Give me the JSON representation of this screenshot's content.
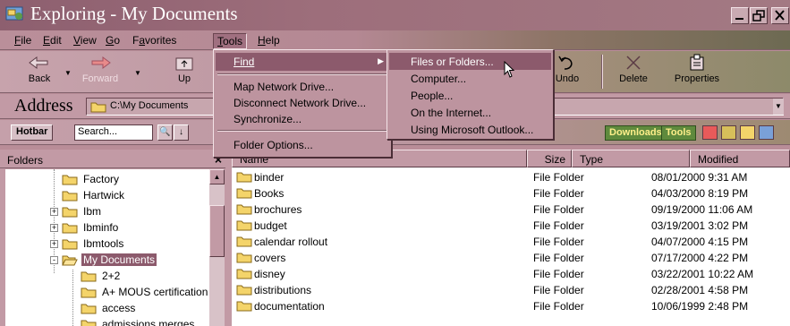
{
  "window": {
    "title": "Exploring - My Documents",
    "controls": [
      "minimize",
      "maximize",
      "close"
    ]
  },
  "menubar": {
    "items": [
      {
        "label": "File",
        "key": "F"
      },
      {
        "label": "Edit",
        "key": "E"
      },
      {
        "label": "View",
        "key": "V"
      },
      {
        "label": "Go",
        "key": "G"
      },
      {
        "label": "Favorites",
        "key": "a"
      },
      {
        "label": "Tools",
        "key": "T"
      },
      {
        "label": "Help",
        "key": "H"
      }
    ]
  },
  "toolbar": {
    "back": "Back",
    "forward": "Forward",
    "up": "Up",
    "undo": "Undo",
    "delete": "Delete",
    "properties": "Properties"
  },
  "address": {
    "label": "Address",
    "value": "C:\\My Documents"
  },
  "links": {
    "hotbar": "Hotbar",
    "search_value": "Search...",
    "downloads": "Downloads",
    "tools": "Tools"
  },
  "tools_menu": {
    "items": [
      {
        "label": "Find",
        "active": true,
        "submenu": true
      },
      {
        "label": "Map Network Drive..."
      },
      {
        "label": "Disconnect Network Drive..."
      },
      {
        "label": "Synchronize..."
      },
      {
        "label": "Folder Options..."
      }
    ]
  },
  "find_submenu": {
    "items": [
      {
        "label": "Files or Folders...",
        "active": true
      },
      {
        "label": "Computer..."
      },
      {
        "label": "People..."
      },
      {
        "label": "On the Internet..."
      },
      {
        "label": "Using Microsoft Outlook..."
      }
    ]
  },
  "folders_pane": {
    "title": "Folders",
    "close": "×",
    "tree": [
      {
        "label": "Factory",
        "level": 2,
        "expander": null
      },
      {
        "label": "Hartwick",
        "level": 2,
        "expander": null
      },
      {
        "label": "Ibm",
        "level": 2,
        "expander": "+"
      },
      {
        "label": "Ibminfo",
        "level": 2,
        "expander": "+"
      },
      {
        "label": "Ibmtools",
        "level": 2,
        "expander": "+"
      },
      {
        "label": "My Documents",
        "level": 2,
        "expander": "-",
        "selected": true
      },
      {
        "label": "2+2",
        "level": 3,
        "expander": null
      },
      {
        "label": "A+ MOUS certification",
        "level": 3,
        "expander": null
      },
      {
        "label": "access",
        "level": 3,
        "expander": null
      },
      {
        "label": "admissions merges",
        "level": 3,
        "expander": null
      }
    ]
  },
  "list": {
    "columns": [
      "Name",
      "Size",
      "Type",
      "Modified"
    ],
    "rows": [
      {
        "name": "binder",
        "size": "",
        "type": "File Folder",
        "modified": "08/01/2000 9:31 AM"
      },
      {
        "name": "Books",
        "size": "",
        "type": "File Folder",
        "modified": "04/03/2000 8:19 PM"
      },
      {
        "name": "brochures",
        "size": "",
        "type": "File Folder",
        "modified": "09/19/2000 11:06 AM"
      },
      {
        "name": "budget",
        "size": "",
        "type": "File Folder",
        "modified": "03/19/2001 3:02 PM"
      },
      {
        "name": "calendar rollout",
        "size": "",
        "type": "File Folder",
        "modified": "04/07/2000 4:15 PM"
      },
      {
        "name": "covers",
        "size": "",
        "type": "File Folder",
        "modified": "07/17/2000 4:22 PM"
      },
      {
        "name": "disney",
        "size": "",
        "type": "File Folder",
        "modified": "03/22/2001 10:22 AM"
      },
      {
        "name": "distributions",
        "size": "",
        "type": "File Folder",
        "modified": "02/28/2001 4:58 PM"
      },
      {
        "name": "documentation",
        "size": "",
        "type": "File Folder",
        "modified": "10/06/1999 2:48 PM"
      }
    ]
  },
  "colors": {
    "theme_mauve": "#c29aa5",
    "highlight": "#8c5a6c",
    "folder_yellow": "#f4d46a"
  }
}
